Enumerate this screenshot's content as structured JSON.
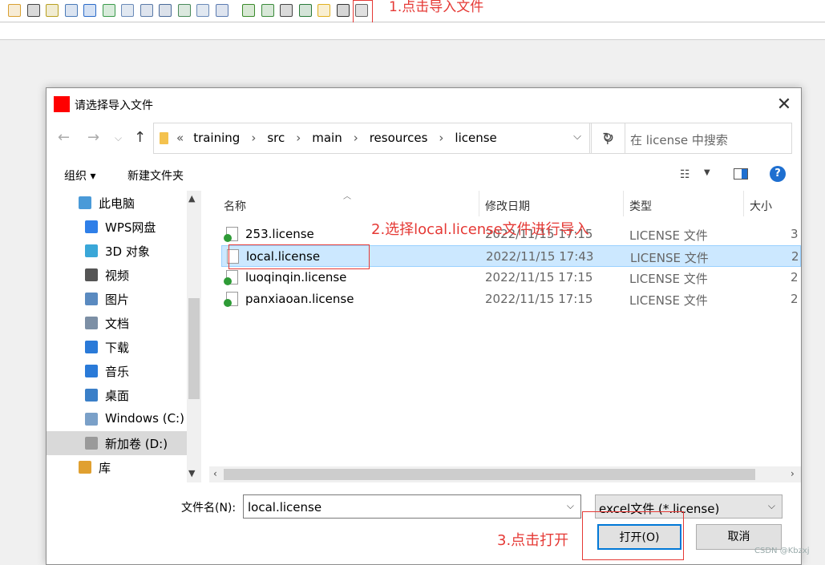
{
  "annotations": {
    "step1": "1.点击导入文件",
    "step2": "2.选择local.license文件进行导入",
    "step3": "3.点击打开"
  },
  "dialog": {
    "title": "请选择导入文件",
    "close_glyph": "✕",
    "title_icon_color": "#ff0000",
    "address": {
      "prefix": "«",
      "crumbs": [
        "training",
        "src",
        "main",
        "resources",
        "license"
      ],
      "separator": "›",
      "dropdown_glyph": "⌵",
      "refresh_glyph": "↻"
    },
    "nav_buttons": {
      "back": "←",
      "forward": "→",
      "recent": "⌵",
      "up": "↑"
    },
    "search": {
      "icon": "⚲",
      "placeholder": "在 license 中搜索"
    },
    "commands": {
      "organize": "组织 ▾",
      "new_folder": "新建文件夹",
      "view_icon": "☷",
      "view_dropdown": "▼",
      "help": "?"
    },
    "nav_pane": {
      "items": [
        {
          "label": "此电脑",
          "icon": "computer-icon",
          "color": "#4a9ad8",
          "sel": false
        },
        {
          "label": "WPS网盘",
          "icon": "cloud-icon",
          "color": "#2f7fe8",
          "sel": false
        },
        {
          "label": "3D 对象",
          "icon": "cube-icon",
          "color": "#3aa7d8",
          "sel": false
        },
        {
          "label": "视频",
          "icon": "film-icon",
          "color": "#555555",
          "sel": false
        },
        {
          "label": "图片",
          "icon": "picture-icon",
          "color": "#5a8ac0",
          "sel": false
        },
        {
          "label": "文档",
          "icon": "document-icon",
          "color": "#7c8fa5",
          "sel": false
        },
        {
          "label": "下载",
          "icon": "download-icon",
          "color": "#2a7ad8",
          "sel": false
        },
        {
          "label": "音乐",
          "icon": "music-icon",
          "color": "#2a7ad8",
          "sel": false
        },
        {
          "label": "桌面",
          "icon": "desktop-icon",
          "color": "#3a7fc8",
          "sel": false
        },
        {
          "label": "Windows (C:)",
          "icon": "drive-icon",
          "color": "#7aa0c8",
          "sel": false
        },
        {
          "label": "新加卷 (D:)",
          "icon": "drive-icon",
          "color": "#9a9a9a",
          "sel": true
        },
        {
          "label": "库",
          "icon": "library-icon",
          "color": "#e0a030",
          "sel": false
        }
      ],
      "scroll_up": "▲",
      "scroll_down": "▼"
    },
    "columns": {
      "name": "名称",
      "date": "修改日期",
      "type": "类型",
      "size": "大小"
    },
    "files": [
      {
        "name": "253.license",
        "date": "2022/11/15 17:15",
        "type": "LICENSE 文件",
        "size": "3",
        "synced": true,
        "selected": false
      },
      {
        "name": "local.license",
        "date": "2022/11/15 17:43",
        "type": "LICENSE 文件",
        "size": "2",
        "synced": false,
        "selected": true
      },
      {
        "name": "luoqinqin.license",
        "date": "2022/11/15 17:15",
        "type": "LICENSE 文件",
        "size": "2",
        "synced": true,
        "selected": false
      },
      {
        "name": "panxiaoan.license",
        "date": "2022/11/15 17:15",
        "type": "LICENSE 文件",
        "size": "2",
        "synced": true,
        "selected": false
      }
    ],
    "hscroll": {
      "left": "‹",
      "right": "›"
    },
    "filename": {
      "label": "文件名(N):",
      "value": "local.license",
      "dropdown_glyph": "⌵"
    },
    "filetype": {
      "value": "excel文件 (*.license)",
      "dropdown_glyph": "⌵"
    },
    "buttons": {
      "open": "打开(O)",
      "cancel": "取消"
    }
  },
  "toolbar": {
    "icons": [
      {
        "name": "pencil-icon",
        "color": "#d8a032"
      },
      {
        "name": "hand-icon",
        "color": "#444444"
      },
      {
        "name": "note-icon",
        "color": "#b8a020"
      },
      {
        "name": "stack-icon",
        "color": "#4a7ab8"
      },
      {
        "name": "word-icon",
        "color": "#2a6ac8"
      },
      {
        "name": "shapes-icon",
        "color": "#3a9a4a"
      },
      {
        "name": "grid-icon",
        "color": "#6a8ab8"
      },
      {
        "name": "form-icon",
        "color": "#5a7aa8"
      },
      {
        "name": "window-icon",
        "color": "#4a6a98"
      },
      {
        "name": "chart-icon",
        "color": "#4a8a5a"
      },
      {
        "name": "layers-icon",
        "color": "#6a8ab8"
      },
      {
        "name": "panels-icon",
        "color": "#5a7ab0"
      },
      {
        "name": "p-icon",
        "color": "#3a8a2a"
      },
      {
        "name": "hammer-icon",
        "color": "#3a8a3a"
      },
      {
        "name": "link-icon",
        "color": "#444444"
      },
      {
        "name": "excel-icon",
        "color": "#2a7a3a"
      },
      {
        "name": "folder-icon",
        "color": "#e0b020"
      },
      {
        "name": "lock-icon",
        "color": "#333333"
      },
      {
        "name": "import-icon",
        "color": "#666666"
      }
    ]
  },
  "watermark": "CSDN @Kbzxj"
}
